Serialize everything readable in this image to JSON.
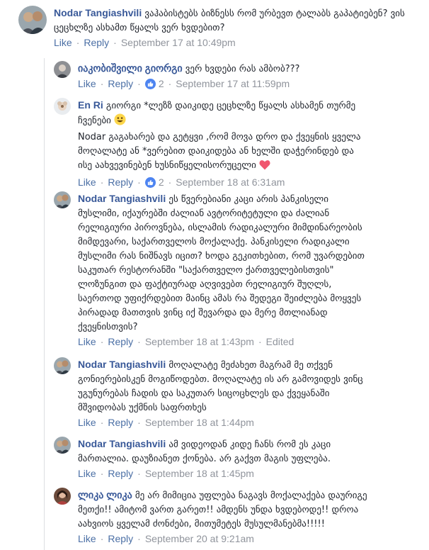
{
  "actions": {
    "like": "Like",
    "reply": "Reply",
    "sep": "·"
  },
  "colors": {
    "link": "#385898",
    "meta": "#90949c",
    "like_badge": "#4d84f1"
  },
  "comments": [
    {
      "author": "Nodar Tangiashvili",
      "text": "ვაჰაბისტებს ბიზნესს რომ ურბევთ ტალაბს გაპატიებენ? ვის\nცეცხლზე ასხამთ წყალს ვერ ხვდებით?",
      "time": "September 17 at 10:49pm",
      "avatar": "photo-couple"
    },
    {
      "author": "იაკობიშვილი გიორგი",
      "text": "ვერ ხვდები რას ამბობ???",
      "time": "September 17 at 11:59pm",
      "likes": "2",
      "avatar": "photo-man"
    },
    {
      "author": "En Ri",
      "text_1": "გიორგი *ლეზზ დაიკიდე ცეცხლზე წყალს ასხამენ თურმე\nჩვენები",
      "text_2": "Nodar გაგახარებ და გეტყვი ,რომ მოვა დრო და ქვეყნის ყველა\nმოღალატე ან *ვერებით დაიკიდება ან ხელში დაჭერინდებ და\nისე აახვევინებენ ხუსნიწყელისორუცელი",
      "time": "September 18 at 6:31am",
      "likes": "2",
      "avatar": "photo-flower"
    },
    {
      "author": "Nodar Tangiashvili",
      "text": "ეს წვერებიანი კაცი არის პანკისელი\nმუსლიმი, იქაურებში ძალიან ავტორიტეტული და ძალიან\nრელიგიური პიროვნება, ისლამის რადიკალური მიმდინარეობის\nმიმდევარი, საქართველოს მოქალაქე. პანკისელი რადიკალი\nმუსლიმი რას ნიშნავს იცით? ხოდა გეკითხებით, რომ უვარდებით\nსაკუთარ რესტორანში \"საქართველო ქართველებისთვის\"\nლოზუნგით და ფაქტიურად აღვივებთ რელიგიურ შუღლს,\nსაერთოდ უფიქრდებით მაინც ამას რა შედეგი შეიძლება მოყვეს\nპირადად მათთვის ვინც იქ შევარდა და მერე მთლიანად\nქვეყნისთვის?",
      "time": "September 18 at 1:43pm",
      "edited": "Edited",
      "avatar": "photo-couple"
    },
    {
      "author": "Nodar Tangiashvili",
      "text": "მოღალატე მეძახეთ მაგრამ მე თქვენ\nგონიერებისკენ მოგიწოდებთ. მოღალატე ის არ გამოვიდეს ვინც\nუგუნურებას ჩადის და საკუთარ სიცოცხლეს და ქვეყანაში\nმშვიდობას უქმნის საფრთხეს",
      "time": "September 18 at 1:44pm",
      "avatar": "photo-couple"
    },
    {
      "author": "Nodar Tangiashvili",
      "text": "ამ ვიდეოდან კიდე ჩანს რომ ეს კაცი\nმართალია. დაუზიანეთ ქონება. არ გაქვთ მაგის უფლება.",
      "time": "September 18 at 1:45pm",
      "avatar": "photo-couple"
    },
    {
      "author": "ლიკა ლიკა",
      "text": "მე არ მიმიცია უფლება ნაგავს მოქალაქება დაურიგე\nმეთქი!! ამიტომ ვართ გარეთ!! ამდენს უნდა ხვდებოდე!! დროა\nაახვიოს ყველამ ძონძები, მითუმეტეს მუსულმანებმა!!!!!",
      "time": "September 20 at 9:21am",
      "avatar": "photo-woman"
    }
  ]
}
